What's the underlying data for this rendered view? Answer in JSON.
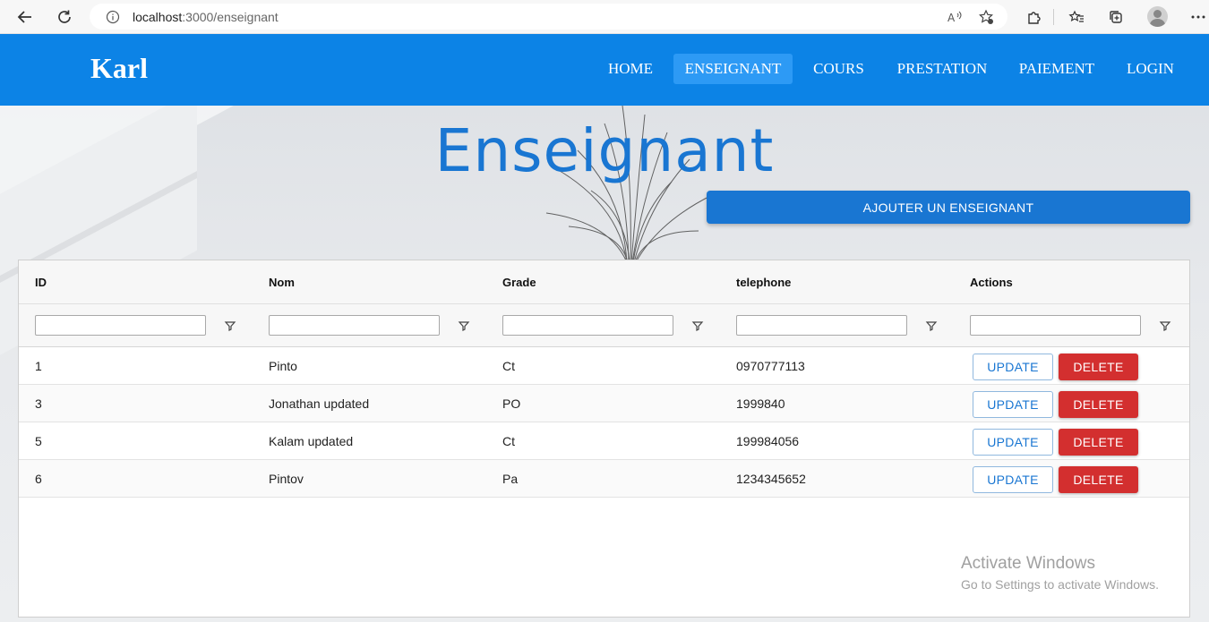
{
  "browser": {
    "url_host": "localhost",
    "url_path": ":3000/enseignant"
  },
  "app": {
    "brand": "Karl",
    "nav": [
      {
        "label": "HOME",
        "active": false
      },
      {
        "label": "ENSEIGNANT",
        "active": true
      },
      {
        "label": "COURS",
        "active": false
      },
      {
        "label": "PRESTATION",
        "active": false
      },
      {
        "label": "PAIEMENT",
        "active": false
      },
      {
        "label": "LOGIN",
        "active": false
      }
    ],
    "accent_color": "#0c83e6"
  },
  "page": {
    "title": "Enseignant",
    "add_button": "AJOUTER UN ENSEIGNANT"
  },
  "grid": {
    "columns": [
      "ID",
      "Nom",
      "Grade",
      "telephone",
      "Actions"
    ],
    "filters": [
      "",
      "",
      "",
      "",
      ""
    ],
    "rows": [
      {
        "id": "1",
        "nom": "Pinto",
        "grade": "Ct",
        "telephone": "0970777113"
      },
      {
        "id": "3",
        "nom": "Jonathan updated",
        "grade": "PO",
        "telephone": "1999840"
      },
      {
        "id": "5",
        "nom": "Kalam updated",
        "grade": "Ct",
        "telephone": "199984056"
      },
      {
        "id": "6",
        "nom": "Pintov",
        "grade": "Pa",
        "telephone": "1234345652"
      }
    ],
    "update_label": "UPDATE",
    "delete_label": "DELETE"
  },
  "watermark": {
    "title": "Activate Windows",
    "subtitle": "Go to Settings to activate Windows."
  }
}
